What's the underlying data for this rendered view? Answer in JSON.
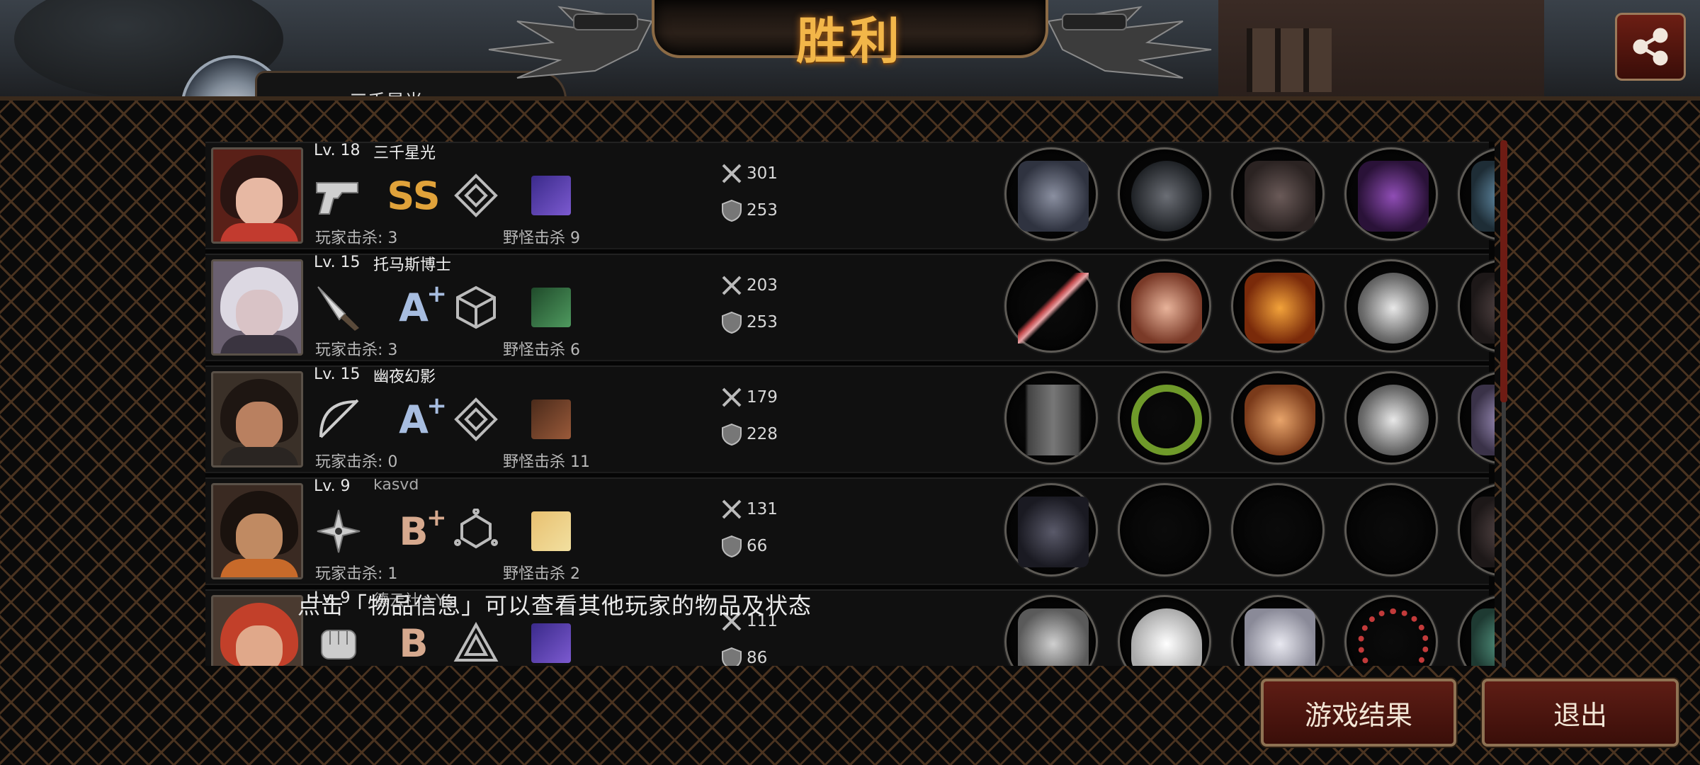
{
  "header": {
    "title": "胜利",
    "partial_name": "三千星光"
  },
  "share_icon": "share-icon",
  "players": [
    {
      "level": "Lv. 18",
      "name": "三千星光",
      "weapon_icon": "pistol-icon",
      "grade": "SS",
      "grade_plus": "",
      "player_kills": "玩家击杀: 3",
      "monster_kills": "野怪击杀 9",
      "attack": "301",
      "defense": "253",
      "items": [
        "gun-item",
        "helmet-item",
        "armor-item",
        "gauntlet-item",
        "boots-item",
        "vest-item"
      ]
    },
    {
      "level": "Lv. 15",
      "name": "托马斯博士",
      "weapon_icon": "knife-icon",
      "grade": "A",
      "grade_plus": "+",
      "player_kills": "玩家击杀: 3",
      "monster_kills": "野怪击杀 6",
      "attack": "203",
      "defense": "253",
      "items": [
        "sword-item",
        "winged-crown-item",
        "flame-armor-item",
        "metal-disc-item",
        "boots-item",
        "earrings-item"
      ]
    },
    {
      "level": "Lv. 15",
      "name": "幽夜幻影",
      "weapon_icon": "bow-icon",
      "grade": "A",
      "grade_plus": "+",
      "player_kills": "玩家击杀: 0",
      "monster_kills": "野怪击杀 11",
      "attack": "179",
      "defense": "228",
      "items": [
        "crossbow-item",
        "laurel-item",
        "grape-item",
        "metal-disc-item",
        "boots-item",
        "quiver-item"
      ]
    },
    {
      "level": "Lv. 9",
      "name": "kasvd",
      "weapon_icon": "shuriken-icon",
      "grade": "B",
      "grade_plus": "+",
      "player_kills": "玩家击杀: 1",
      "monster_kills": "野怪击杀 2",
      "attack": "131",
      "defense": "66",
      "items": [
        "blade-item",
        "",
        "",
        "",
        "boots-item",
        "pearl-item"
      ]
    },
    {
      "level": "Lv. 9",
      "name": "德云社丶Ys",
      "weapon_icon": "fist-icon",
      "grade": "B",
      "grade_plus": "",
      "player_kills": "",
      "monster_kills": "",
      "attack": "111",
      "defense": "86",
      "items": [
        "gauntlet-item",
        "white-helmet-item",
        "suit-item",
        "bracelet-item",
        "sneaker-item",
        "box-item"
      ]
    }
  ],
  "footer": {
    "hint": "点击「物品信息」可以查看其他玩家的物品及状态",
    "results_button": "游戏结果",
    "exit_button": "退出"
  }
}
